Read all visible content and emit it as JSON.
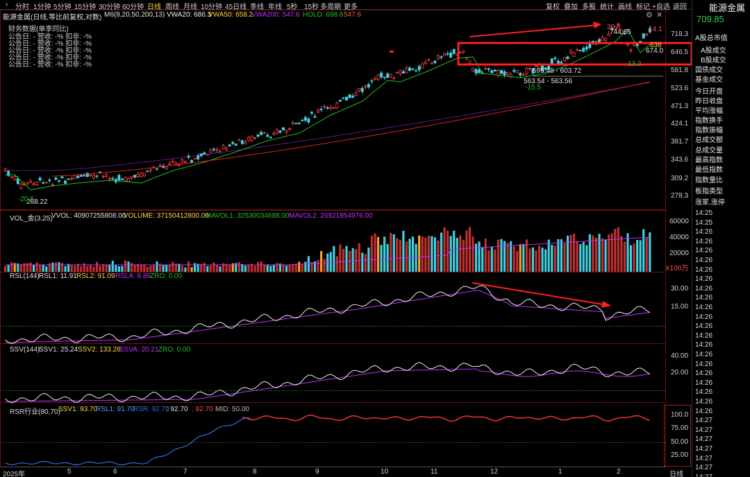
{
  "toolbar": {
    "periods": [
      "分时",
      "1分钟",
      "5分钟",
      "15分钟",
      "30分钟",
      "60分钟",
      "日线",
      "周线",
      "月线",
      "10分钟",
      "45日线",
      "季线",
      "年线",
      "5秒",
      "15秒",
      "多周期",
      "更多"
    ],
    "active_index": 6,
    "more_caret": "›",
    "right": [
      "复权",
      "叠加",
      "多股",
      "统计",
      "画线",
      "标记",
      "+自选",
      "返回"
    ]
  },
  "header": {
    "title": "能源金属(日线,等比前复权,对数)",
    "ma_label": "M6(8,20,50,200,13)",
    "vwa20": "VWA20: 686.3",
    "vwa50": "VWA50: 658.2",
    "vwa200": "VWA200: 547.6",
    "hold": "HOLD: 698.6",
    "hold2": "547.6",
    "icons": [
      "gear-icon",
      "close-icon"
    ]
  },
  "fin": {
    "title": "财务数据(单季同比)",
    "rows": [
      "公告日: -   营收: -%   扣非: -%",
      "公告日: -   营收: -%   扣非: -%",
      "公告日: -   营收: -%   扣非: -%",
      "公告日: -   营收: -%   扣非: -%",
      "公告日: -   营收: -%   扣非: -%"
    ]
  },
  "price_axis": [
    "718.3",
    "646.5",
    "581.8",
    "523.6",
    "471.3",
    "424.1",
    "381.7",
    "343.6",
    "309.2",
    "278.3"
  ],
  "annotations": {
    "low": "268.22",
    "low_pct": "-20.6",
    "high": "744.65",
    "high_pct": "30.8",
    "right_pct": "14.1",
    "r1": "599.48 - 603.72",
    "r2": "563.54 - 563.56",
    "r2_pct": "-15.5",
    "p674": "674.0",
    "p6": "636",
    "p132": "13.2"
  },
  "vol": {
    "label": "VOL_金(3,25)",
    "vvol": "VVOL: 40907255808.00",
    "volume": "VOLUME: 37150412800.00",
    "mavol1": "MAVOL1: 32530034688.00",
    "mavol2": "MAVOL2: 26921854976.00",
    "axis": [
      "60000",
      "40000",
      "20000"
    ],
    "unit": "X100万"
  },
  "rsl": {
    "label": "RSL(144)",
    "rsl1": "RSL1: 11.91",
    "rsl2": "RSL2: 91.09",
    "rsla": "RSLA: 8.86",
    "zro": "ZRO: 0.00",
    "axis": [
      "30.00",
      "15.00"
    ]
  },
  "ssv": {
    "label": "SSV(144)",
    "ssv1": "SSV1: 25.24",
    "ssv2": "SSV2: 133.26",
    "ssva": "SSVA: 20.21",
    "zro": "ZRO: 0.00",
    "axis": [
      "40.00",
      "20.00"
    ]
  },
  "rsr": {
    "label": "RSR行业(80,70)",
    "ssv1": "SSV1: 93.70",
    "rsl1": "RSL1: 91.70",
    "rsr": "RSR: 92.70",
    "v4": ": 92.70",
    "v5": ": 92.70",
    "mid": "MID: 50.00",
    "axis": [
      "100.0",
      "75.00",
      "50.00",
      "25.00"
    ]
  },
  "x_axis": [
    "2025年",
    "5",
    "6",
    "7",
    "8",
    "9",
    "10",
    "11",
    "12",
    "1",
    "2"
  ],
  "x_axis_unit": "日线",
  "right_panel": {
    "title": "能源金属",
    "price": "709.85",
    "items": [
      "A股总市值",
      "A股成交",
      "B股成交",
      "国债成交",
      "基金成交",
      "今日开盘",
      "昨日收盘",
      "平均涨幅",
      "指数换手",
      "指数振幅",
      "总成交额",
      "总成交量",
      "最高指数",
      "最低指数",
      "指数量比",
      "板指类型",
      "涨家.涨停"
    ],
    "times": [
      "14:25",
      "14:25",
      "14:26",
      "14:26",
      "14:26",
      "14:26",
      "14:26",
      "14:26",
      "14:26",
      "14:26",
      "14:26",
      "14:26",
      "14:26",
      "14:26",
      "14:26",
      "14:26",
      "14:26",
      "14:26",
      "14:26",
      "14:26",
      "14:26",
      "14:26",
      "14:27",
      "14:27",
      "14:27",
      "14:27",
      "14:27",
      "14:27",
      "14:27"
    ]
  },
  "colors": {
    "up": "#ff4040",
    "down": "#40d0e0",
    "ma_green": "#20c020",
    "ma_purple": "#c030ff",
    "annot_red": "#ff2020",
    "highlight": "#ffd54a"
  }
}
